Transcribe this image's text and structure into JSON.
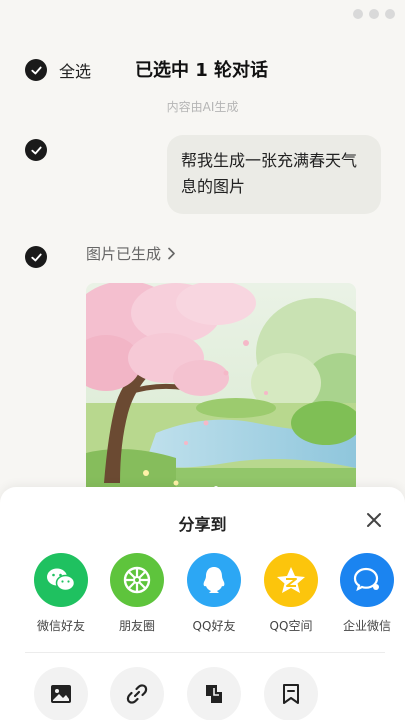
{
  "header": {
    "select_all_label": "全选",
    "title": "已选中 1 轮对话"
  },
  "ai_note": "内容由AI生成",
  "conversation": {
    "user_message": "帮我生成一张充满春天气息的图片",
    "assistant_link": "图片已生成"
  },
  "share_sheet": {
    "title": "分享到",
    "targets": [
      {
        "label": "微信好友",
        "icon": "wechat-icon",
        "color": "#1fc160"
      },
      {
        "label": "朋友圈",
        "icon": "moments-icon",
        "color": "#5ec43c"
      },
      {
        "label": "QQ好友",
        "icon": "qq-icon",
        "color": "#2ca7f4"
      },
      {
        "label": "QQ空间",
        "icon": "qzone-icon",
        "color": "#fcc50c"
      },
      {
        "label": "企业微信",
        "icon": "wecom-icon",
        "color": "#1b84f0"
      }
    ],
    "actions": [
      {
        "icon": "image-icon"
      },
      {
        "icon": "link-icon"
      },
      {
        "icon": "long-image-icon"
      },
      {
        "icon": "bookmark-icon"
      }
    ]
  },
  "colors": {
    "background": "#f7f6f3",
    "check": "#1a1a1a",
    "bubble": "#ebebe6"
  }
}
